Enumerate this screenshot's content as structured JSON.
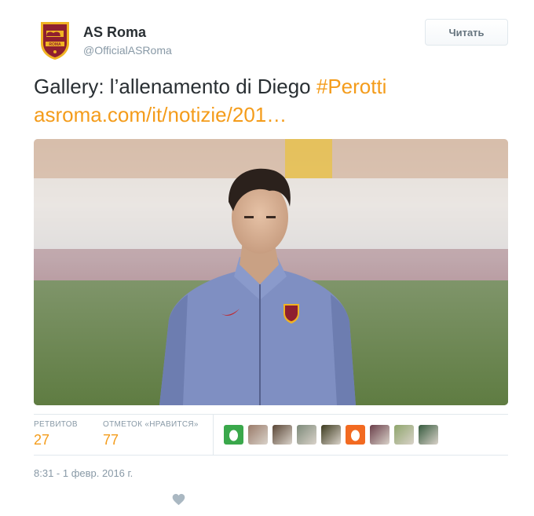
{
  "account": {
    "name": "AS Roma",
    "handle": "@OfficialASRoma",
    "logo_text": "ROMA"
  },
  "follow_button": {
    "label": "Читать"
  },
  "tweet": {
    "text_prefix": "Gallery: l’allenamento di Diego ",
    "hashtag": "#Perotti",
    "link": "asroma.com/it/notizie/201…"
  },
  "stats": {
    "retweets_label": "РЕТВИТОВ",
    "retweets_value": "27",
    "likes_label": "ОТМЕТОК «НРАВИТСЯ»",
    "likes_value": "77"
  },
  "likers": [
    {
      "name": "egg-avatar-green",
      "color": "#3aa84b"
    },
    {
      "name": "avatar-photo",
      "color": "#9a7b6a"
    },
    {
      "name": "avatar-photo",
      "color": "#5a4636"
    },
    {
      "name": "avatar-photo",
      "color": "#7d8a7a"
    },
    {
      "name": "avatar-photo",
      "color": "#3c3a1e"
    },
    {
      "name": "egg-avatar-orange",
      "color": "#f26a21"
    },
    {
      "name": "avatar-photo",
      "color": "#6a3e4a"
    },
    {
      "name": "avatar-photo",
      "color": "#8ea56c"
    },
    {
      "name": "avatar-photo",
      "color": "#355a3d"
    }
  ],
  "timestamp": "8:31 - 1 февр. 2016 г.",
  "colors": {
    "accent": "#f49c1b",
    "text": "#292f33",
    "muted": "#8899a6",
    "roma_red": "#8e1f2f",
    "roma_gold": "#f0b323"
  }
}
